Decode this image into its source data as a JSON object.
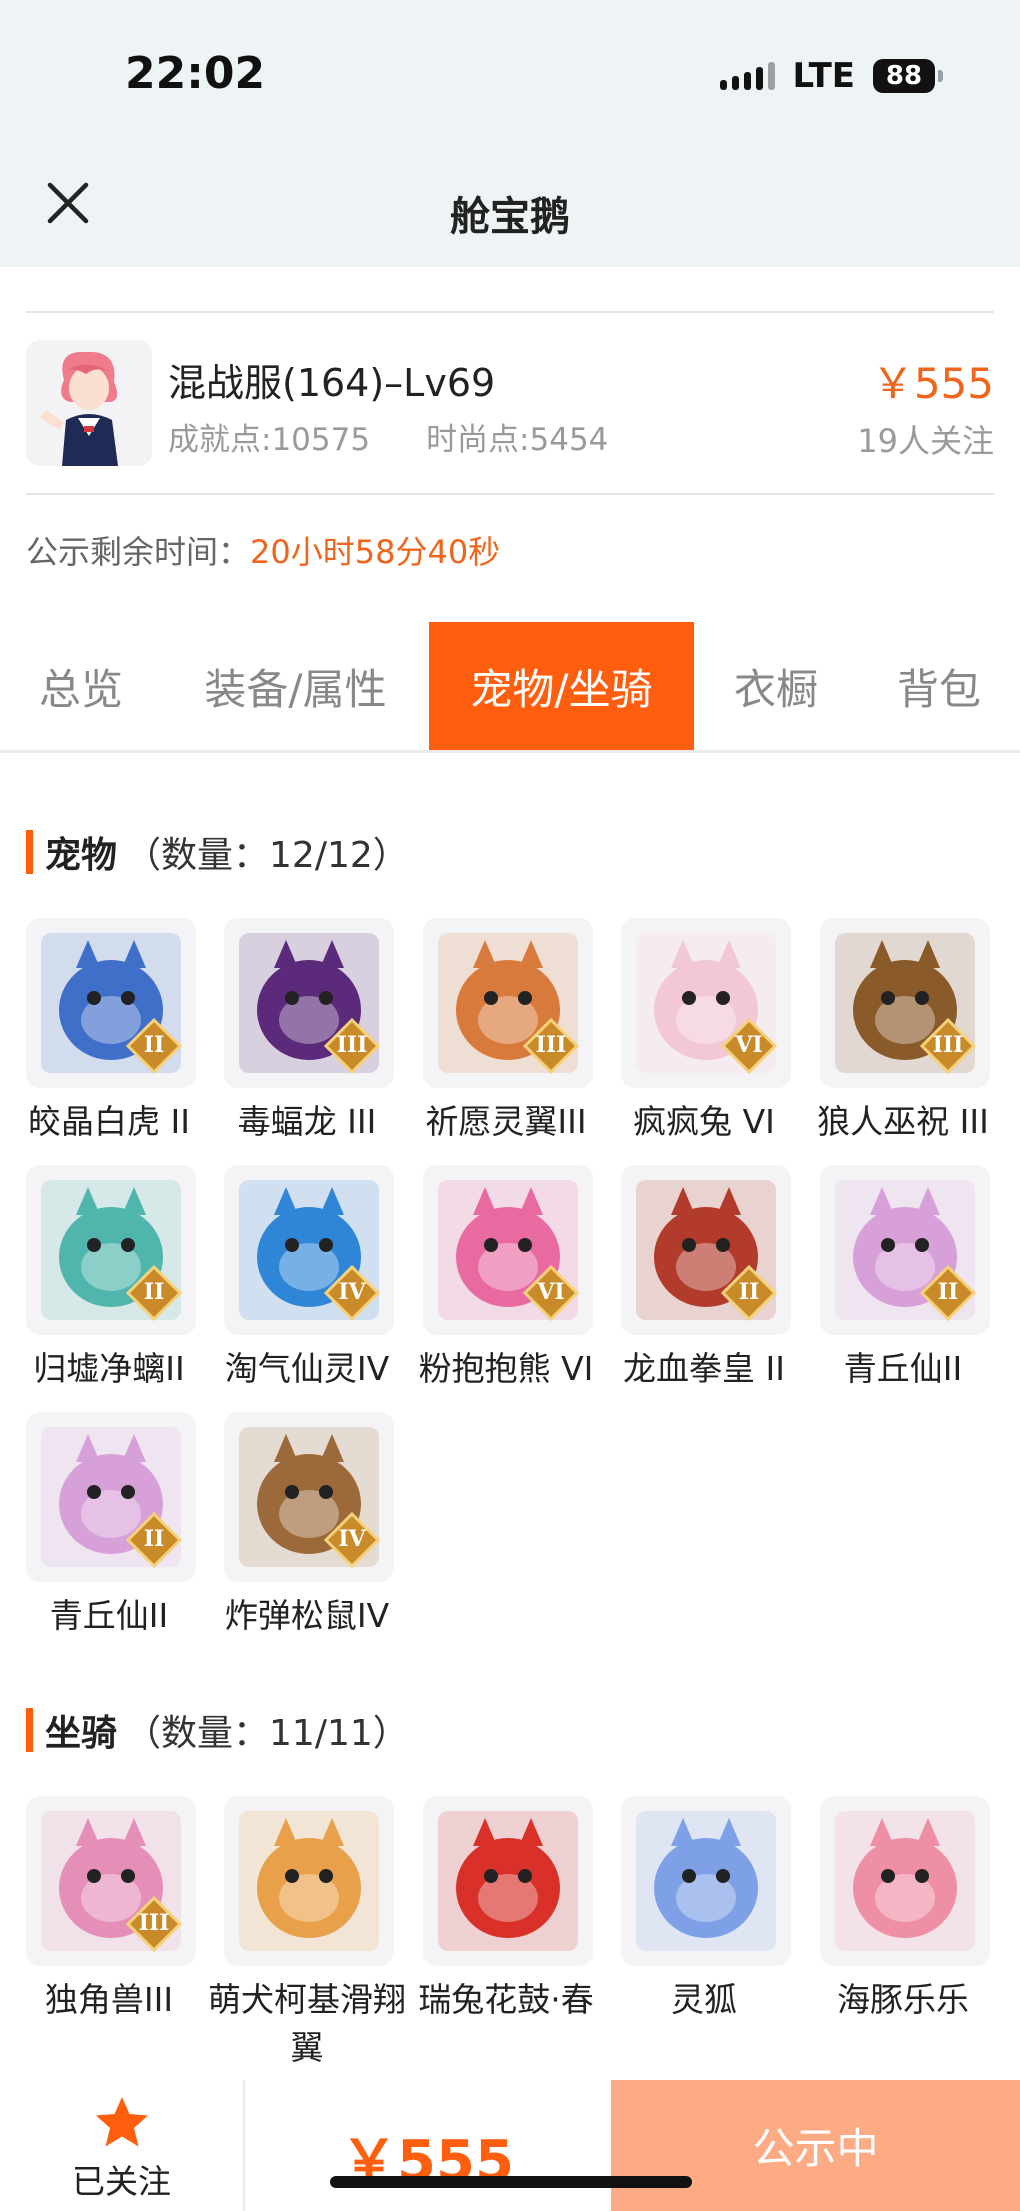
{
  "status_bar": {
    "time": "22:02",
    "network": "LTE",
    "battery": "88"
  },
  "nav": {
    "title": "舱宝鹅",
    "close_icon": "close-icon"
  },
  "role": {
    "name": "混战服(164)–Lv69",
    "achievement": "成就点:10575",
    "fashion": "时尚点:5454",
    "price": "￥555",
    "watchers": "19人关注"
  },
  "countdown": {
    "label": "公示剩余时间：",
    "value": "20小时58分40秒"
  },
  "tabs": [
    {
      "label": "总览"
    },
    {
      "label": "装备/属性"
    },
    {
      "label": "宠物/坐骑",
      "active": true
    },
    {
      "label": "衣橱"
    },
    {
      "label": "背包"
    }
  ],
  "pets": {
    "title": "宠物",
    "count": "（数量：12/12）",
    "items": [
      {
        "name": "皎晶白虎 II",
        "badge": "II",
        "color": "#3f6fc9"
      },
      {
        "name": "毒蝠龙 III",
        "badge": "III",
        "color": "#5b2a7a"
      },
      {
        "name": "祈愿灵翼III",
        "badge": "III",
        "color": "#d77a3b"
      },
      {
        "name": "疯疯兔 VI",
        "badge": "VI",
        "color": "#f2c8d8"
      },
      {
        "name": "狼人巫祝 III",
        "badge": "III",
        "color": "#8a5a2a"
      },
      {
        "name": "归墟净螭II",
        "badge": "II",
        "color": "#4fb5ad"
      },
      {
        "name": "淘气仙灵IV",
        "badge": "IV",
        "color": "#2f86d6"
      },
      {
        "name": "粉抱抱熊 VI",
        "badge": "VI",
        "color": "#e86aa0"
      },
      {
        "name": "龙血拳皇 II",
        "badge": "II",
        "color": "#b33b2b"
      },
      {
        "name": "青丘仙II",
        "badge": "II",
        "color": "#d8a0d8"
      },
      {
        "name": "青丘仙II",
        "badge": "II",
        "color": "#d8a0d8"
      },
      {
        "name": "炸弹松鼠IV",
        "badge": "IV",
        "color": "#9c6a3a"
      }
    ]
  },
  "mounts": {
    "title": "坐骑",
    "count": "（数量：11/11）",
    "items": [
      {
        "name": "独角兽III",
        "badge": "III",
        "color": "#e58fb8"
      },
      {
        "name": "萌犬柯基滑翔翼",
        "badge": "",
        "color": "#e9a04a"
      },
      {
        "name": "瑞兔花鼓·春",
        "badge": "",
        "color": "#d9302a"
      },
      {
        "name": "灵狐",
        "badge": "",
        "color": "#7da0e6"
      },
      {
        "name": "海豚乐乐",
        "badge": "",
        "color": "#ee8fa6"
      }
    ]
  },
  "footer": {
    "follow_label": "已关注",
    "price": "￥555",
    "status": "公示中"
  },
  "colors": {
    "accent": "#ff5e0e",
    "price": "#f0651c",
    "status_btn": "#fdab84"
  }
}
